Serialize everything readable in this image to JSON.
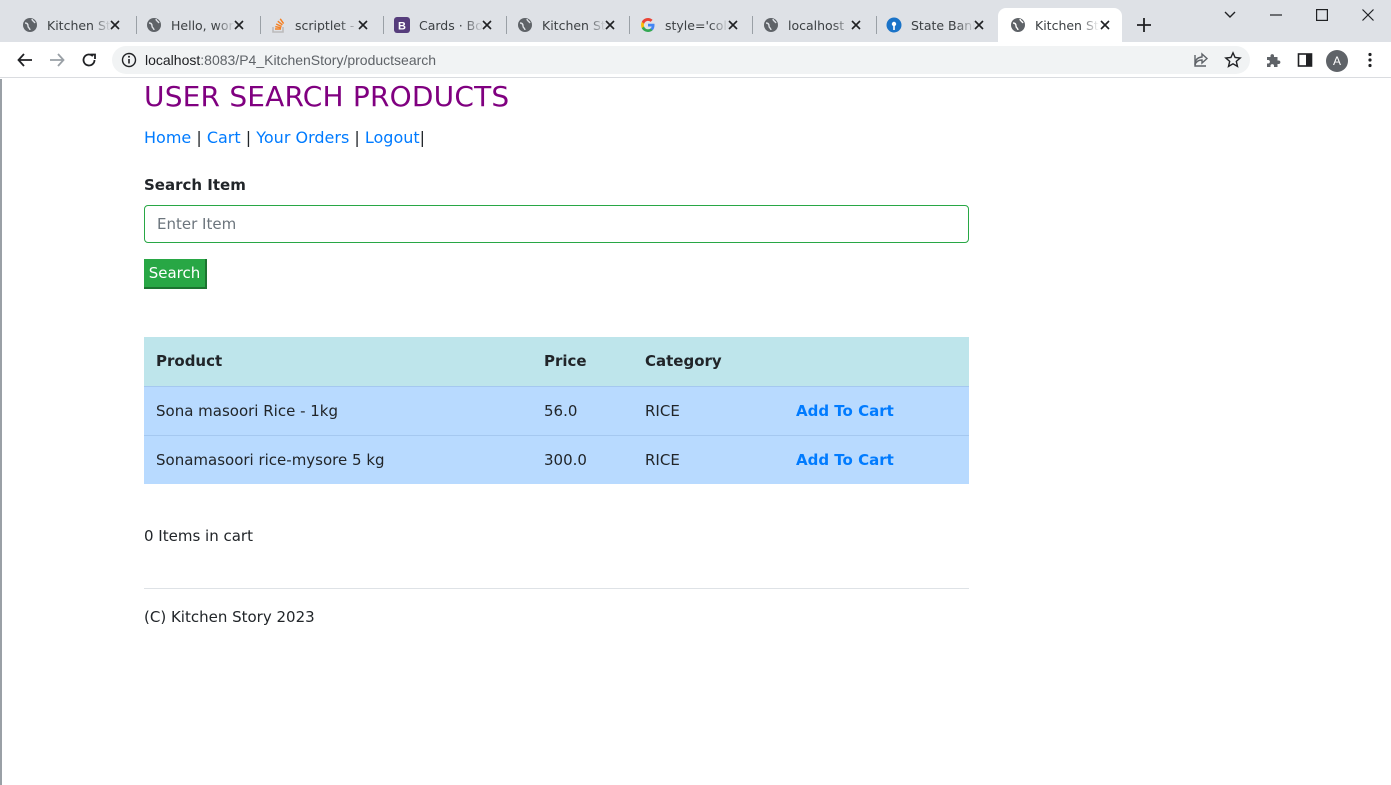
{
  "browser": {
    "tabs": [
      {
        "title": "Kitchen Story",
        "icon": "globe-icon"
      },
      {
        "title": "Hello, world",
        "icon": "globe-icon"
      },
      {
        "title": "scriptlet - How",
        "icon": "stackoverflow-icon"
      },
      {
        "title": "Cards · Bootstrap",
        "icon": "bootstrap-icon"
      },
      {
        "title": "Kitchen Story",
        "icon": "globe-icon"
      },
      {
        "title": "style='color",
        "icon": "google-icon"
      },
      {
        "title": "localhost",
        "icon": "globe-icon"
      },
      {
        "title": "State Bank",
        "icon": "sbi-icon"
      },
      {
        "title": "Kitchen Story",
        "icon": "globe-icon"
      }
    ],
    "active_tab_index": 8,
    "url_host": "localhost",
    "url_path": ":8083/P4_KitchenStory/productsearch",
    "profile_initial": "A"
  },
  "page": {
    "title": "USER SEARCH PRODUCTS",
    "nav": {
      "home": "Home",
      "cart": "Cart",
      "orders": "Your Orders",
      "logout": "Logout",
      "separator": "|"
    },
    "search": {
      "label": "Search Item",
      "placeholder": "Enter Item",
      "value": "",
      "button": "Search"
    },
    "table": {
      "headers": [
        "Product",
        "Price",
        "Category",
        ""
      ],
      "rows": [
        {
          "product": "Sona masoori Rice - 1kg",
          "price": "56.0",
          "category": "RICE",
          "action": "Add To Cart"
        },
        {
          "product": "Sonamasoori rice-mysore 5 kg",
          "price": "300.0",
          "category": "RICE",
          "action": "Add To Cart"
        }
      ]
    },
    "cart_status": "0 Items in cart",
    "footer": "(C) Kitchen Story 2023"
  },
  "colors": {
    "title": "#800080",
    "link": "#007bff",
    "success": "#28a745",
    "table_header": "#bee5eb",
    "table_row": "#b8daff"
  }
}
